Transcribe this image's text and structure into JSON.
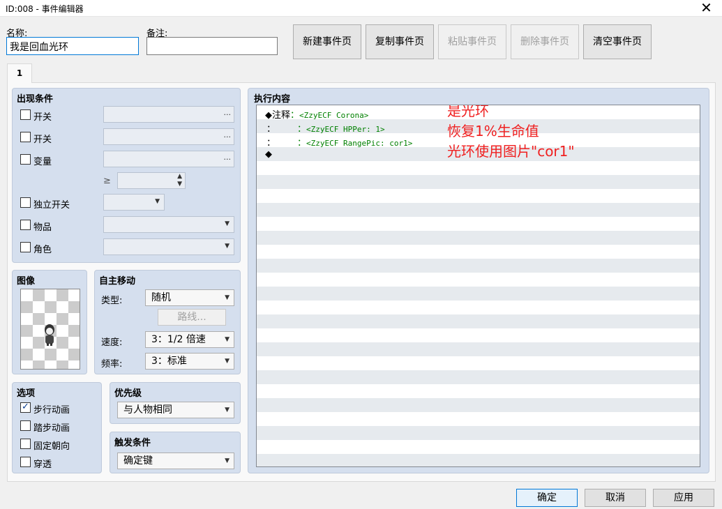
{
  "window": {
    "title": "ID:008 - 事件编辑器",
    "close": "✕"
  },
  "name_label": "名称:",
  "name_value": "我是回血光环",
  "note_label": "备注:",
  "note_value": "",
  "toolbar": {
    "new": "新建事件页",
    "copy": "复制事件页",
    "paste": "粘贴事件页",
    "delete": "删除事件页",
    "clear": "清空事件页"
  },
  "tab": "1",
  "conditions": {
    "title": "出现条件",
    "switch1": "开关",
    "switch2": "开关",
    "variable": "变量",
    "ge": "≥",
    "self_switch": "独立开关",
    "item": "物品",
    "actor": "角色",
    "dots": "..."
  },
  "image": {
    "title": "图像"
  },
  "autonomous": {
    "title": "自主移动",
    "type_label": "类型:",
    "type_value": "随机",
    "route": "路线...",
    "speed_label": "速度:",
    "speed_value": "3：1/2 倍速",
    "freq_label": "频率:",
    "freq_value": "3：标准"
  },
  "options": {
    "title": "选项",
    "walking": "步行动画",
    "stepping": "踏步动画",
    "direction_fix": "固定朝向",
    "through": "穿透"
  },
  "priority": {
    "title": "优先级",
    "value": "与人物相同"
  },
  "trigger": {
    "title": "触发条件",
    "value": "确定键"
  },
  "contents": {
    "title": "执行内容",
    "lines": [
      {
        "prefix": "◆注释",
        "sep": "：",
        "text": "<ZzyECF Corona>"
      },
      {
        "prefix": "：",
        "sep": "：",
        "text": "<ZzyECF HPPer: 1>"
      },
      {
        "prefix": "：",
        "sep": "：",
        "text": "<ZzyECF RangePic: cor1>"
      },
      {
        "prefix": "◆",
        "sep": "",
        "text": ""
      }
    ],
    "annotations": [
      "是光环",
      "恢复1%生命值",
      "光环使用图片\"cor1\""
    ]
  },
  "footer": {
    "ok": "确定",
    "cancel": "取消",
    "apply": "应用"
  },
  "icons": {
    "check": "check-icon",
    "dropdown": "dropdown-arrow-icon",
    "character": "character-sprite-icon"
  },
  "colors": {
    "panel": "#d5dfee",
    "comment_green": "#008000",
    "annotation_red": "#f02020",
    "selection_blue": "#0078d7"
  }
}
